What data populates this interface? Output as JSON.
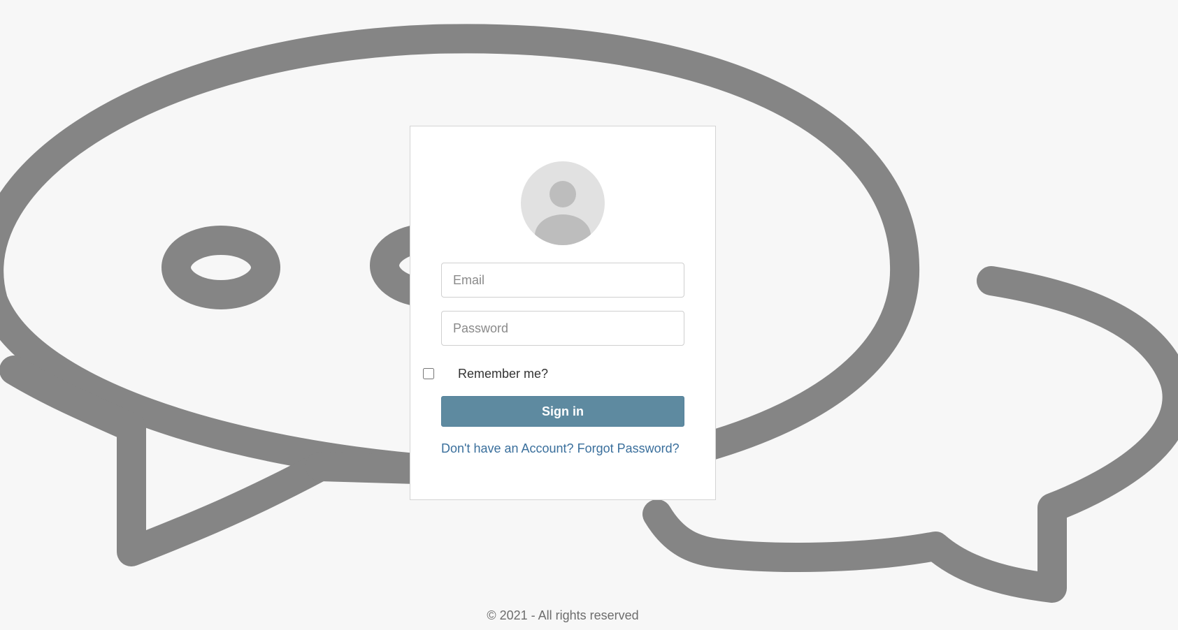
{
  "background": {
    "icon": "chat-bubbles-icon",
    "stroke_color": "#858585",
    "page_color": "#f7f7f7"
  },
  "avatar": {
    "icon": "user-avatar-icon"
  },
  "form": {
    "email_placeholder": "Email",
    "password_placeholder": "Password",
    "remember_label": "Remember me?",
    "remember_checked": false,
    "signin_label": "Sign in",
    "register_link": "Don't have an Account?",
    "forgot_link": "Forgot Password?",
    "accent_color": "#5e8aa0",
    "link_color": "#3a6f9c"
  },
  "footer": {
    "text": "© 2021 - All rights reserved"
  }
}
